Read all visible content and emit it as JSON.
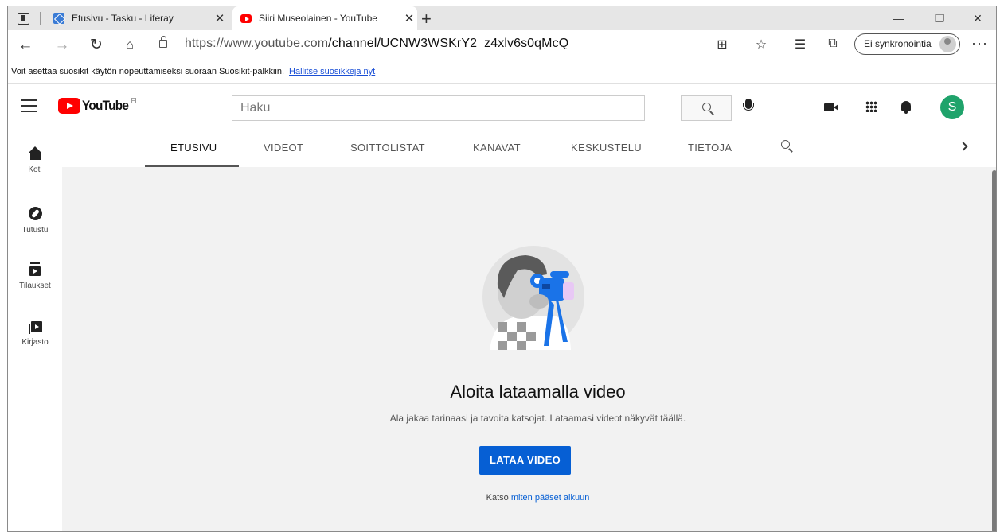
{
  "browser": {
    "tabs": [
      {
        "title": "Etusivu - Tasku - Liferay",
        "close": "✕"
      },
      {
        "title": "Siiri Museolainen - YouTube",
        "close": "✕"
      }
    ],
    "new_tab": "+",
    "window_controls": {
      "minimize": "—",
      "restore": "❐",
      "close": "✕"
    },
    "url_host": "https://www.youtube.com",
    "url_path": "/channel/UCNW3WSKrY2_z4xlv6s0qMcQ",
    "sync_label": "Ei synkronointia",
    "more": "···",
    "favorites_bar": {
      "text": "Voit asettaa suosikit käytön nopeuttamiseksi suoraan Suosikit-palkkiin.",
      "link": "Hallitse suosikkeja nyt"
    }
  },
  "youtube": {
    "logo_word": "YouTube",
    "logo_region": "FI",
    "search_placeholder": "Haku",
    "avatar_letter": "S",
    "sidebar": [
      {
        "label": "Koti",
        "icon": "home-icon"
      },
      {
        "label": "Tutustu",
        "icon": "explore-icon"
      },
      {
        "label": "Tilaukset",
        "icon": "subscriptions-icon"
      },
      {
        "label": "Kirjasto",
        "icon": "library-icon"
      }
    ],
    "channel_tabs": [
      "ETUSIVU",
      "VIDEOT",
      "SOITTOLISTAT",
      "KANAVAT",
      "KESKUSTELU",
      "TIETOJA"
    ],
    "active_tab": "ETUSIVU",
    "empty_state": {
      "title": "Aloita lataamalla video",
      "subtitle": "Ala jakaa tarinaasi ja tavoita katsojat. Lataamasi videot näkyvät täällä.",
      "button": "LATAA VIDEO",
      "help_prefix": "Katso",
      "help_link": "miten pääset alkuun"
    }
  },
  "colors": {
    "accent_blue": "#065fd4",
    "youtube_red": "#ff0000",
    "avatar_green": "#1fa36b"
  }
}
